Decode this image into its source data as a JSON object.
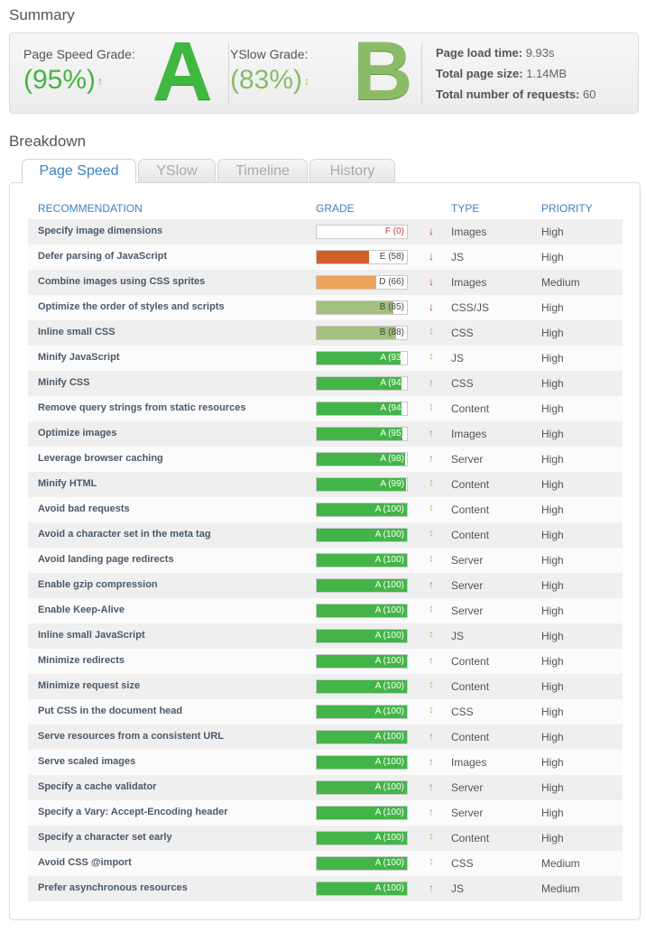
{
  "summary": {
    "title": "Summary",
    "pagespeed": {
      "label": "Page Speed Grade:",
      "percent": "(95%)",
      "letter": "A",
      "trend": "up",
      "color": "#44b544"
    },
    "yslow": {
      "label": "YSlow Grade:",
      "percent": "(83%)",
      "letter": "B",
      "trend": "flat",
      "color": "#8cbb68"
    },
    "stats": [
      {
        "label": "Page load time:",
        "value": "9.93s"
      },
      {
        "label": "Total page size:",
        "value": "1.14MB"
      },
      {
        "label": "Total number of requests:",
        "value": "60"
      }
    ]
  },
  "breakdown": {
    "title": "Breakdown",
    "tabs": [
      {
        "label": "Page Speed",
        "active": true
      },
      {
        "label": "YSlow",
        "active": false
      },
      {
        "label": "Timeline",
        "active": false
      },
      {
        "label": "History",
        "active": false
      }
    ],
    "columns": {
      "recommendation": "RECOMMENDATION",
      "grade": "GRADE",
      "type": "TYPE",
      "priority": "PRIORITY"
    },
    "grade_colors": {
      "A": "#43b548",
      "B": "#a4c07e",
      "D": "#eca45c",
      "E": "#d35f2a",
      "F": "#cc3333"
    },
    "rows": [
      {
        "name": "Specify image dimensions",
        "letter": "F",
        "score": 0,
        "label": "F (0)",
        "trend": "down",
        "type": "Images",
        "priority": "High"
      },
      {
        "name": "Defer parsing of JavaScript",
        "letter": "E",
        "score": 58,
        "label": "E (58)",
        "trend": "down",
        "type": "JS",
        "priority": "High"
      },
      {
        "name": "Combine images using CSS sprites",
        "letter": "D",
        "score": 66,
        "label": "D (66)",
        "trend": "down",
        "type": "Images",
        "priority": "Medium"
      },
      {
        "name": "Optimize the order of styles and scripts",
        "letter": "B",
        "score": 85,
        "label": "B (85)",
        "trend": "down",
        "type": "CSS/JS",
        "priority": "High"
      },
      {
        "name": "Inline small CSS",
        "letter": "B",
        "score": 88,
        "label": "B (88)",
        "trend": "flat",
        "type": "CSS",
        "priority": "High"
      },
      {
        "name": "Minify JavaScript",
        "letter": "A",
        "score": 93,
        "label": "A (93)",
        "trend": "flat",
        "type": "JS",
        "priority": "High"
      },
      {
        "name": "Minify CSS",
        "letter": "A",
        "score": 94,
        "label": "A (94)",
        "trend": "up",
        "type": "CSS",
        "priority": "High"
      },
      {
        "name": "Remove query strings from static resources",
        "letter": "A",
        "score": 94,
        "label": "A (94)",
        "trend": "flat",
        "type": "Content",
        "priority": "High"
      },
      {
        "name": "Optimize images",
        "letter": "A",
        "score": 95,
        "label": "A (95)",
        "trend": "up",
        "type": "Images",
        "priority": "High"
      },
      {
        "name": "Leverage browser caching",
        "letter": "A",
        "score": 98,
        "label": "A (98)",
        "trend": "up",
        "type": "Server",
        "priority": "High"
      },
      {
        "name": "Minify HTML",
        "letter": "A",
        "score": 99,
        "label": "A (99)",
        "trend": "flat",
        "type": "Content",
        "priority": "High"
      },
      {
        "name": "Avoid bad requests",
        "letter": "A",
        "score": 100,
        "label": "A (100)",
        "trend": "flat",
        "type": "Content",
        "priority": "High"
      },
      {
        "name": "Avoid a character set in the meta tag",
        "letter": "A",
        "score": 100,
        "label": "A (100)",
        "trend": "flat",
        "type": "Content",
        "priority": "High"
      },
      {
        "name": "Avoid landing page redirects",
        "letter": "A",
        "score": 100,
        "label": "A (100)",
        "trend": "flat",
        "type": "Server",
        "priority": "High"
      },
      {
        "name": "Enable gzip compression",
        "letter": "A",
        "score": 100,
        "label": "A (100)",
        "trend": "up",
        "type": "Server",
        "priority": "High"
      },
      {
        "name": "Enable Keep-Alive",
        "letter": "A",
        "score": 100,
        "label": "A (100)",
        "trend": "flat",
        "type": "Server",
        "priority": "High"
      },
      {
        "name": "Inline small JavaScript",
        "letter": "A",
        "score": 100,
        "label": "A (100)",
        "trend": "flat",
        "type": "JS",
        "priority": "High"
      },
      {
        "name": "Minimize redirects",
        "letter": "A",
        "score": 100,
        "label": "A (100)",
        "trend": "up",
        "type": "Content",
        "priority": "High"
      },
      {
        "name": "Minimize request size",
        "letter": "A",
        "score": 100,
        "label": "A (100)",
        "trend": "flat",
        "type": "Content",
        "priority": "High"
      },
      {
        "name": "Put CSS in the document head",
        "letter": "A",
        "score": 100,
        "label": "A (100)",
        "trend": "flat",
        "type": "CSS",
        "priority": "High"
      },
      {
        "name": "Serve resources from a consistent URL",
        "letter": "A",
        "score": 100,
        "label": "A (100)",
        "trend": "up",
        "type": "Content",
        "priority": "High"
      },
      {
        "name": "Serve scaled images",
        "letter": "A",
        "score": 100,
        "label": "A (100)",
        "trend": "up",
        "type": "Images",
        "priority": "High"
      },
      {
        "name": "Specify a cache validator",
        "letter": "A",
        "score": 100,
        "label": "A (100)",
        "trend": "up",
        "type": "Server",
        "priority": "High"
      },
      {
        "name": "Specify a Vary: Accept-Encoding header",
        "letter": "A",
        "score": 100,
        "label": "A (100)",
        "trend": "up",
        "type": "Server",
        "priority": "High"
      },
      {
        "name": "Specify a character set early",
        "letter": "A",
        "score": 100,
        "label": "A (100)",
        "trend": "flat",
        "type": "Content",
        "priority": "High"
      },
      {
        "name": "Avoid CSS @import",
        "letter": "A",
        "score": 100,
        "label": "A (100)",
        "trend": "flat",
        "type": "CSS",
        "priority": "Medium"
      },
      {
        "name": "Prefer asynchronous resources",
        "letter": "A",
        "score": 100,
        "label": "A (100)",
        "trend": "up",
        "type": "JS",
        "priority": "Medium"
      }
    ]
  }
}
